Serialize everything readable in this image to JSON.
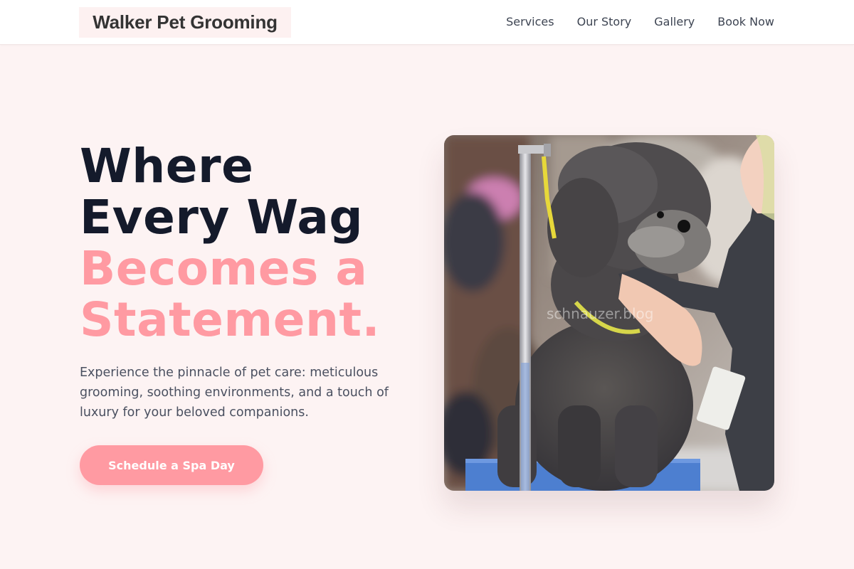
{
  "nav": {
    "brand": "Walker Pet Grooming",
    "links": [
      "Services",
      "Our Story",
      "Gallery",
      "Book Now"
    ]
  },
  "hero": {
    "title_lines": [
      "Where",
      "Every Wag",
      "Becomes a",
      "Statement."
    ],
    "description": "Experience the pinnacle of pet care: meticulous grooming, soothing environments, and a touch of luxury for your beloved companions.",
    "cta_label": "Schedule a Spa Day",
    "image_watermark": "schnauzer.blog"
  },
  "colors": {
    "accent_pink": "#ff9aa2",
    "heading_dark": "#141a2b",
    "background": "#fdf3f3",
    "body_text": "#4a5060"
  }
}
